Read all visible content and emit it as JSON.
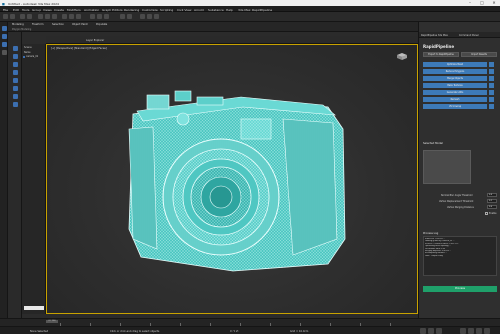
{
  "window": {
    "title": "Untitled - Autodesk 3ds Max 2024",
    "minimize": "–",
    "maximize": "□",
    "close": "✕"
  },
  "menu": [
    "File",
    "Edit",
    "Tools",
    "Group",
    "Views",
    "Create",
    "Modifiers",
    "Animation",
    "Graph Editors",
    "Rendering",
    "Customize",
    "Scripting",
    "Civil View",
    "Arnold",
    "Substance",
    "Help",
    "3ds Max",
    "RapidPipeline"
  ],
  "ribbon": {
    "tabs": [
      "Modeling",
      "Freeform",
      "Selection",
      "Object Paint",
      "Populate"
    ],
    "sub_label": "Polygon Modeling"
  },
  "scene": {
    "title": "Scene",
    "items": [
      "Scene Explorer",
      "Name",
      "camera_01"
    ]
  },
  "viewport": {
    "label": "[+] [Perspective] [Standard] [Edged Faces]",
    "strip_items": [
      "Layer Explorer"
    ]
  },
  "right_panel": {
    "tabs": [
      "RapidPipeline 3ds Max",
      "Command Panel"
    ],
    "brand": "RapidPipeline",
    "top_buttons": [
      "Export to RapidPipeline",
      "Import Results"
    ],
    "list_items": [
      "Optimize Mesh",
      "Reduce Polygons",
      "Merge Objects",
      "Bake Textures",
      "Generate LODs",
      "Remesh",
      "UV Unwrap"
    ],
    "section_title": "Selected Model",
    "fields": [
      {
        "label": "Normal Blur Angle Threshold",
        "value": "0.5"
      },
      {
        "label": "Vertex Displacement Threshold",
        "value": "0.1"
      },
      {
        "label": "Vertex Merging Distance",
        "value": "0.0"
      }
    ],
    "checkbox_label": "Enable",
    "log_title": "Process Log",
    "log_lines": [
      "Started at 11:42:03 ...",
      "Loading geometry: camera_01 ...",
      "Vertices: 1,284,903  Faces: 2,531,112",
      "Optimizing mesh topology ...",
      "Decimation ratio: 0.35",
      "Merging duplicate vertices ...",
      "Recomputing normals ...",
      "Done. Output ready."
    ],
    "go_button": "Process"
  },
  "timeline": {
    "frame_current": "0 / 100"
  },
  "status": {
    "selection": "None Selected",
    "hint": "Click or click-and-drag to select objects",
    "coords": "X:  Y:  Z:",
    "grid": "Grid = 10.0cm"
  },
  "colors": {
    "wireframe": "#5fd6d2",
    "selection_border": "#c8a200",
    "accent_blue": "#3d7ab8",
    "go_green": "#1fa06a"
  }
}
